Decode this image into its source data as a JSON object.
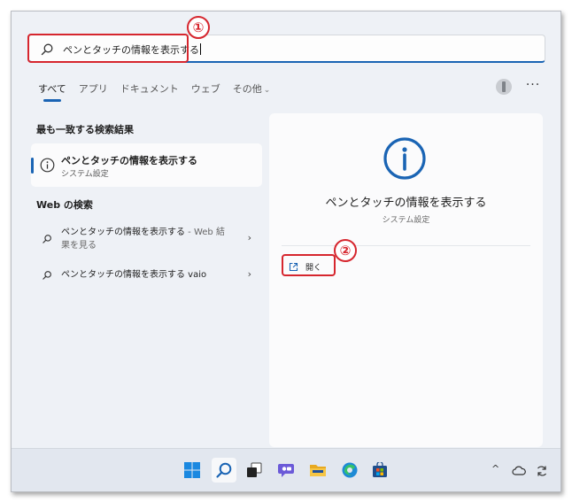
{
  "search": {
    "value": "ペンとタッチの情報を表示する"
  },
  "annotations": {
    "step1": "①",
    "step2": "②"
  },
  "tabs": [
    {
      "label": "すべて"
    },
    {
      "label": "アプリ"
    },
    {
      "label": "ドキュメント"
    },
    {
      "label": "ウェブ"
    },
    {
      "label": "その他",
      "chevron": "⌄"
    }
  ],
  "header": {
    "more_label": "···"
  },
  "best_match": {
    "section_title": "最も一致する検索結果",
    "title": "ペンとタッチの情報を表示する",
    "subtitle": "システム設定"
  },
  "web_search": {
    "section_title": "Web の検索",
    "results": [
      {
        "title": "ペンとタッチの情報を表示する",
        "suffix": " - Web 結",
        "suffix2": "果を見る",
        "arrow": "›"
      },
      {
        "title": "ペンとタッチの情報を表示する vaio",
        "arrow": "›"
      }
    ]
  },
  "detail": {
    "title": "ペンとタッチの情報を表示する",
    "subtitle": "システム設定",
    "open_label": "開く"
  },
  "tray": {
    "chevron": "^"
  },
  "colors": {
    "accent": "#1a64b4",
    "annotation": "#d6262e"
  }
}
